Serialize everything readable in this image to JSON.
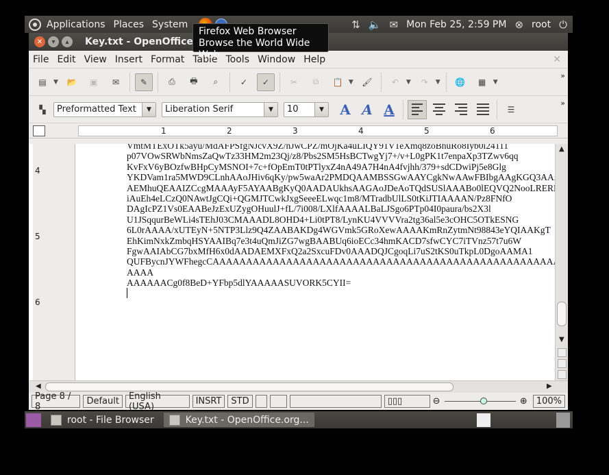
{
  "top_panel": {
    "menus": [
      "Applications",
      "Places",
      "System"
    ],
    "datetime": "Mon Feb 25,  2:59 PM",
    "user": "root"
  },
  "tooltip": {
    "line1": "Firefox Web Browser",
    "line2": "Browse the World Wide Web"
  },
  "window": {
    "title": "Key.txt - OpenOffice."
  },
  "menubar": [
    "File",
    "Edit",
    "View",
    "Insert",
    "Format",
    "Table",
    "Tools",
    "Window",
    "Help"
  ],
  "format_bar": {
    "style": "Preformatted Text",
    "font": "Liberation Serif",
    "size": "10"
  },
  "ruler_numbers": [
    "1",
    "2",
    "3",
    "4",
    "5",
    "6"
  ],
  "vruler_numbers": [
    "4",
    "5",
    "6"
  ],
  "document_lines": [
    "VmtMTExOTk5ayu/MdAFPSfgNJcvX9Z/nJwCPZ/mOjKa4uLIQY91V1eXmq8zoBhuRo8Iyb0i24111",
    "p07VOwSRWbNmsZaQwTz33HM2m23Qj/z8/Pbs2SM5HsBCTwgYj7+/v+L0gPK1t7enpaXp3TZwv6qq",
    "KvFxV6yBOzfwBHpCyMSNOI+7c+fOpEmT0tPTlyxZ4nA49A7H4nA4fvjhh/379+sdCDwiPj5e8Glg",
    "YKDVam1ra5MWD9CLnhAAoJHiv6qKy/pw5waAr2PMDQAAMBSSGwAAYCgkNwAAwFBIbgAAgKGQ3AAA",
    "AEMhuQEAAIZCcgMAAAyF5AYAABgKyQ0AADAUkhsAAGAoJDeAoTQdSUSlAAABo0lEQVQ2NooLRERE",
    "iAuEh4eLCzQ0NAwtJgCQi+QGMJTCwkJxgSeeeELwqc1m8/MTradbUlLS0tKiJTIAAAAN/Pz8FNfO",
    "DAgIcPZ1Vs0EAABeJzExUZygOHuulJ+fL/7i008/LXlfAAAALBaLJSgo6PTp04I0paura/bs2X3l",
    "U1JSqqurBeWLi4sTEhJ03CMAAADL8OHD4+Li0tPT8/LynKU4VVVVra2tg36al5e3cOHC5OTkESNG",
    "6L0rAAAA/xUTEyN+5NTP3Llz9Q4ZAABAKDg4WGVmk5GRoXewAAAAKmRnZytmNt98843eYQIAAKgT",
    "EhKimNxkZmbqHSYAAIBq7e3t4uQmJiZG7wgBAABUq6ioECc34hmKACD7sfwCYC7iTVnz57t7u6W",
    "FgwAAIAbCG7bxMfH6x0dAADAEMXFxQ2a2SxcuFDv0AAADQJCgoqLi7uS2tKS0uTkpL0DgoAAMA1",
    "QUFBycnJYWFhegcCAAAAAAAAAAAAAAAAAAAAAAAAAAAAAAAAAAAAAAAAAAAAAAAAAAAAAAAAAA",
    "AAAA",
    "AAAAAACg0f8BeD+YFbp5dlYAAAAASUVORK5CYII="
  ],
  "statusbar": {
    "page": "Page 8 / 8",
    "style": "Default",
    "language": "English (USA)",
    "insert_mode": "INSRT",
    "selection_mode": "STD",
    "zoom": "100%"
  },
  "taskbar": {
    "items": [
      "root - File Browser",
      "Key.txt - OpenOffice.org..."
    ]
  }
}
